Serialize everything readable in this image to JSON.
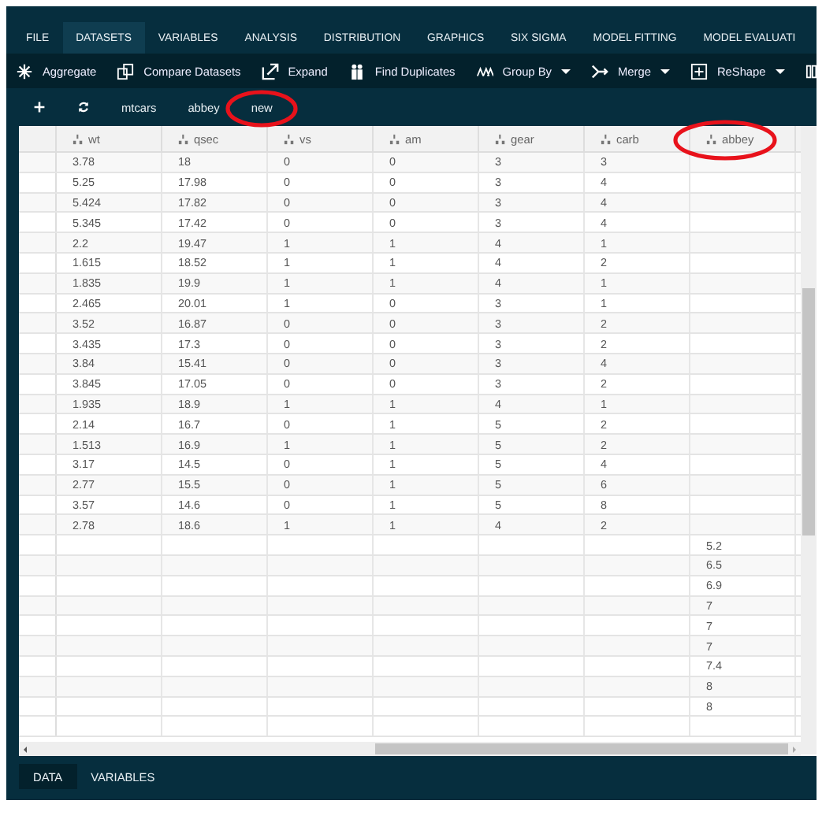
{
  "menu": [
    {
      "label": "FILE",
      "selected": false
    },
    {
      "label": "DATASETS",
      "selected": true
    },
    {
      "label": "VARIABLES",
      "selected": false
    },
    {
      "label": "ANALYSIS",
      "selected": false
    },
    {
      "label": "DISTRIBUTION",
      "selected": false
    },
    {
      "label": "GRAPHICS",
      "selected": false
    },
    {
      "label": "SIX SIGMA",
      "selected": false
    },
    {
      "label": "MODEL FITTING",
      "selected": false
    },
    {
      "label": "MODEL EVALUATI",
      "selected": false
    }
  ],
  "toolbar": [
    {
      "label": "Aggregate",
      "kind": "aggregate",
      "dropdown": false
    },
    {
      "label": "Compare Datasets",
      "kind": "compare",
      "dropdown": false
    },
    {
      "label": "Expand",
      "kind": "expand",
      "dropdown": false
    },
    {
      "label": "Find Duplicates",
      "kind": "duplicates",
      "dropdown": false
    },
    {
      "label": "Group By",
      "kind": "groupby",
      "dropdown": true
    },
    {
      "label": "Merge",
      "kind": "merge",
      "dropdown": true
    },
    {
      "label": "ReShape",
      "kind": "reshape",
      "dropdown": true
    }
  ],
  "datasets": [
    "mtcars",
    "abbey",
    "new"
  ],
  "table": {
    "columns": [
      "wt",
      "qsec",
      "vs",
      "am",
      "gear",
      "carb",
      "abbey"
    ],
    "rows": [
      [
        "3.78",
        "18",
        "0",
        "0",
        "3",
        "3",
        null
      ],
      [
        "5.25",
        "17.98",
        "0",
        "0",
        "3",
        "4",
        null
      ],
      [
        "5.424",
        "17.82",
        "0",
        "0",
        "3",
        "4",
        null
      ],
      [
        "5.345",
        "17.42",
        "0",
        "0",
        "3",
        "4",
        null
      ],
      [
        "2.2",
        "19.47",
        "1",
        "1",
        "4",
        "1",
        null
      ],
      [
        "1.615",
        "18.52",
        "1",
        "1",
        "4",
        "2",
        null
      ],
      [
        "1.835",
        "19.9",
        "1",
        "1",
        "4",
        "1",
        null
      ],
      [
        "2.465",
        "20.01",
        "1",
        "0",
        "3",
        "1",
        null
      ],
      [
        "3.52",
        "16.87",
        "0",
        "0",
        "3",
        "2",
        null
      ],
      [
        "3.435",
        "17.3",
        "0",
        "0",
        "3",
        "2",
        null
      ],
      [
        "3.84",
        "15.41",
        "0",
        "0",
        "3",
        "4",
        null
      ],
      [
        "3.845",
        "17.05",
        "0",
        "0",
        "3",
        "2",
        null
      ],
      [
        "1.935",
        "18.9",
        "1",
        "1",
        "4",
        "1",
        null
      ],
      [
        "2.14",
        "16.7",
        "0",
        "1",
        "5",
        "2",
        null
      ],
      [
        "1.513",
        "16.9",
        "1",
        "1",
        "5",
        "2",
        null
      ],
      [
        "3.17",
        "14.5",
        "0",
        "1",
        "5",
        "4",
        null
      ],
      [
        "2.77",
        "15.5",
        "0",
        "1",
        "5",
        "6",
        null
      ],
      [
        "3.57",
        "14.6",
        "0",
        "1",
        "5",
        "8",
        null
      ],
      [
        "2.78",
        "18.6",
        "1",
        "1",
        "4",
        "2",
        null
      ],
      [
        null,
        null,
        null,
        null,
        null,
        null,
        "5.2"
      ],
      [
        null,
        null,
        null,
        null,
        null,
        null,
        "6.5"
      ],
      [
        null,
        null,
        null,
        null,
        null,
        null,
        "6.9"
      ],
      [
        null,
        null,
        null,
        null,
        null,
        null,
        "7"
      ],
      [
        null,
        null,
        null,
        null,
        null,
        null,
        "7"
      ],
      [
        null,
        null,
        null,
        null,
        null,
        null,
        "7"
      ],
      [
        null,
        null,
        null,
        null,
        null,
        null,
        "7.4"
      ],
      [
        null,
        null,
        null,
        null,
        null,
        null,
        "8"
      ],
      [
        null,
        null,
        null,
        null,
        null,
        null,
        "8"
      ]
    ]
  },
  "bottom_tabs": [
    {
      "label": "DATA",
      "selected": true
    },
    {
      "label": "VARIABLES",
      "selected": false
    }
  ]
}
